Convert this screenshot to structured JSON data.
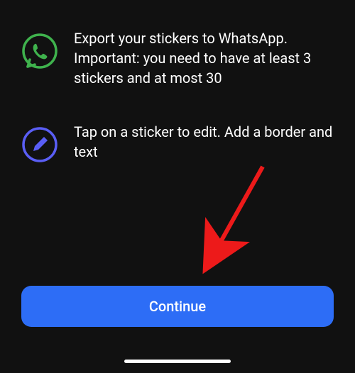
{
  "info": {
    "whatsapp": {
      "text": "Export your stickers to WhatsApp. Important: you need to have at least 3 stickers and at most 30"
    },
    "edit": {
      "text": "Tap on a sticker to edit. Add a border and text"
    }
  },
  "button": {
    "continue_label": "Continue"
  }
}
